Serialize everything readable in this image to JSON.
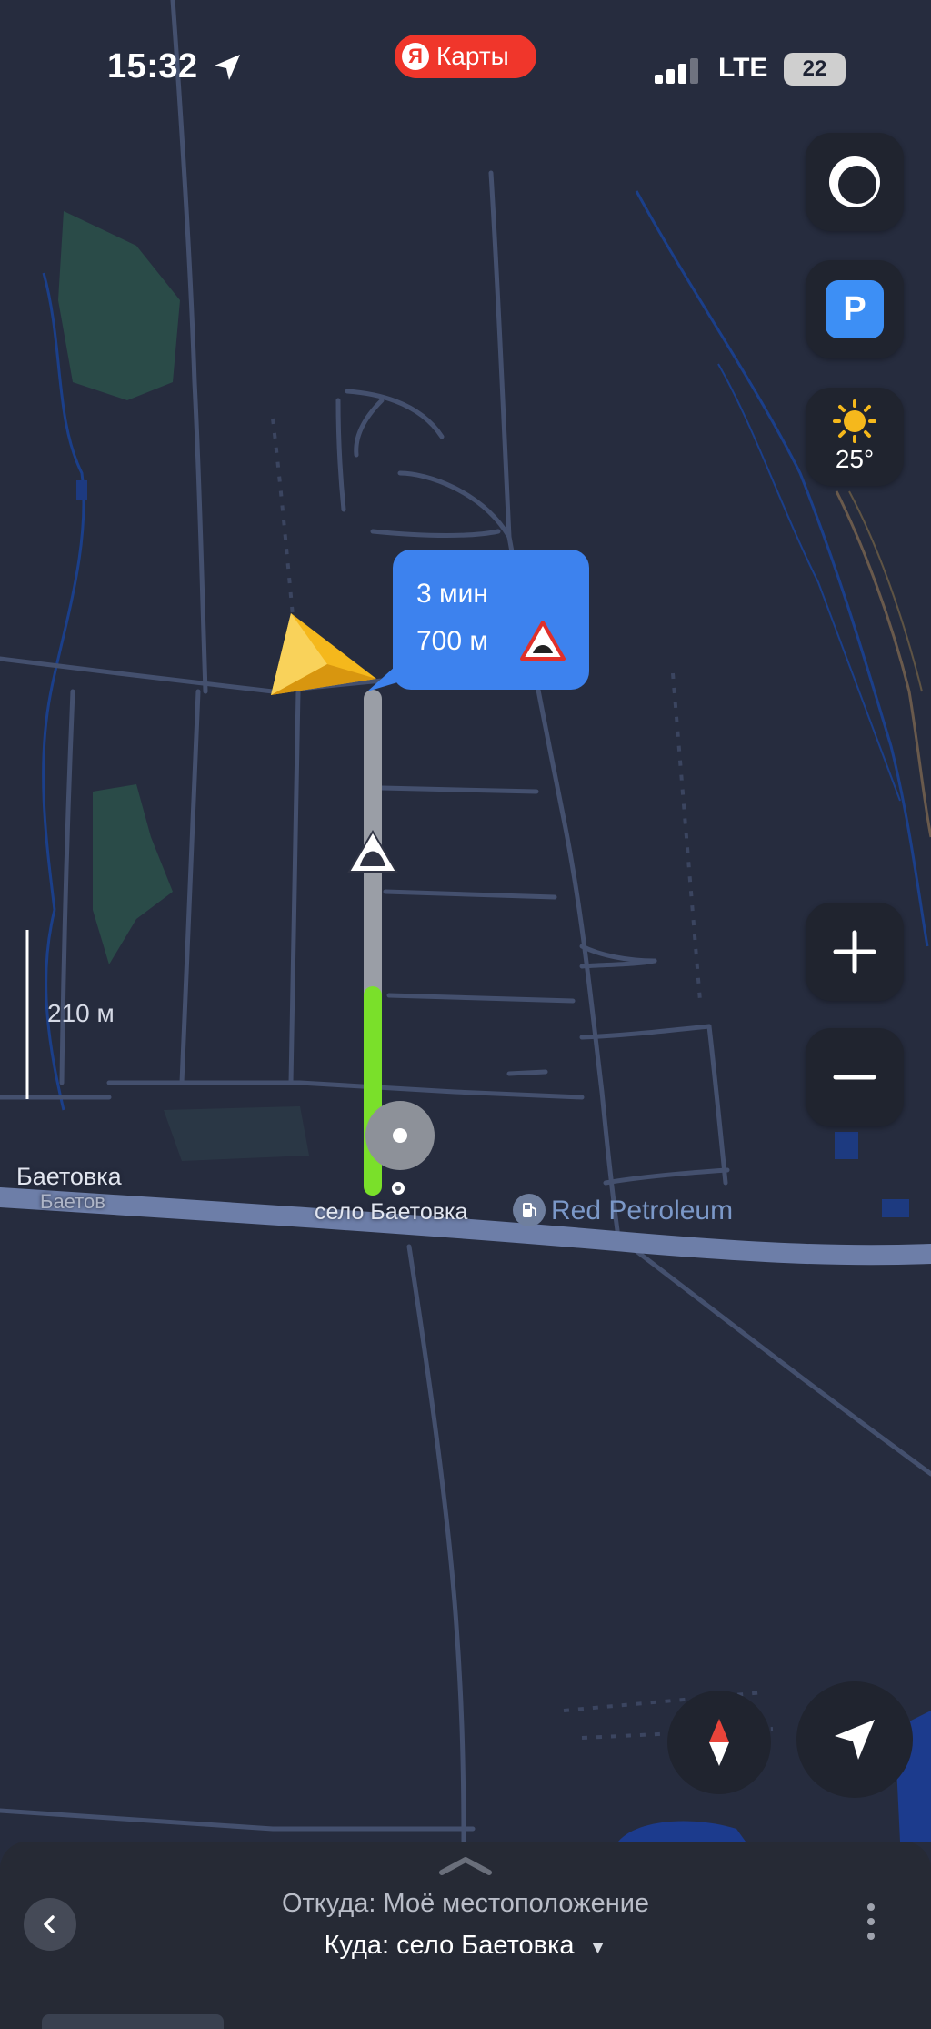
{
  "status_bar": {
    "time": "15:32",
    "app_badge": "Я",
    "app_name": "Карты",
    "network": "LTE",
    "battery": "22"
  },
  "map_controls": {
    "weather_temp": "25°",
    "parking_label": "P",
    "zoom_in": "+",
    "zoom_out": "−"
  },
  "route_bubble": {
    "time": "3 мин",
    "distance": "700 м"
  },
  "map_labels": {
    "scale": "210 м",
    "village": "Баетовка",
    "village_alt": "Баетов",
    "destination": "село Баетовка",
    "poi": "Red Petroleum"
  },
  "colors": {
    "route_green": "#7ae02a",
    "route_gray": "#9a9ea6",
    "bubble_blue": "#3d82ee",
    "navigator_yellow": "#f5b81c",
    "map_background": "#262c3e"
  },
  "bottom_panel": {
    "from_text": "Откуда: Моё местоположение",
    "to_text": "Куда: село Баетовка",
    "to_arrow": "▼"
  }
}
